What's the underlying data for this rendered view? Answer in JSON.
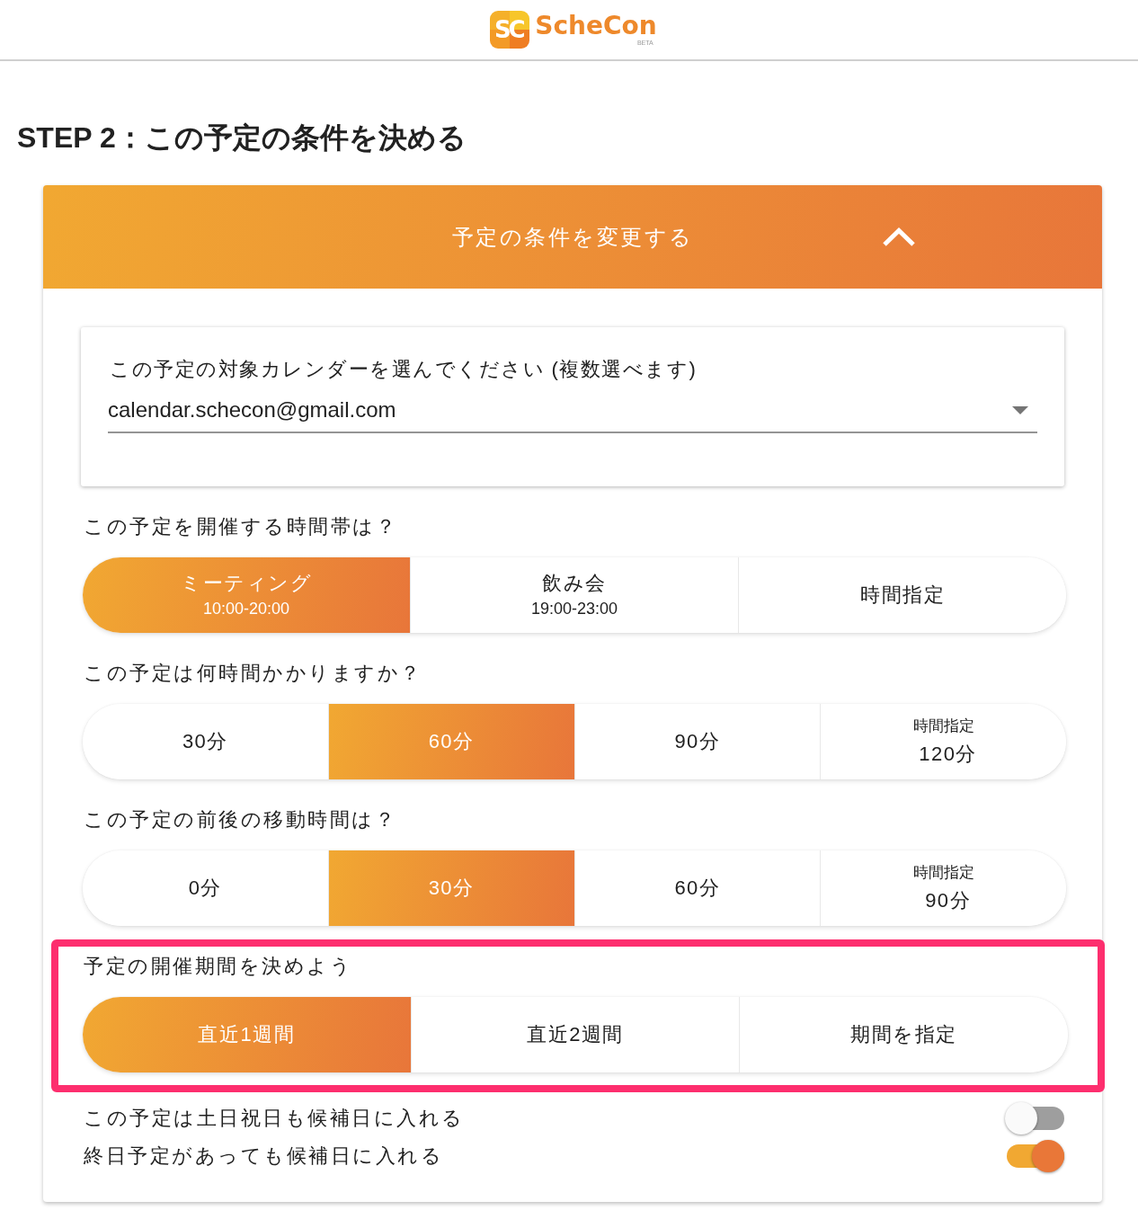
{
  "header": {
    "logo_mark": "SC",
    "logo_text": "ScheCon",
    "logo_badge": "BETA"
  },
  "step_title": "STEP 2：この予定の条件を決める",
  "panel": {
    "title": "予定の条件を変更する",
    "expanded": true
  },
  "calendar_select": {
    "label": "この予定の対象カレンダーを選んでください (複数選べます)",
    "value": "calendar.schecon@gmail.com"
  },
  "groups": [
    {
      "question": "この予定を開催する時間帯は？",
      "highlighted": false,
      "options": [
        {
          "label": "ミーティング",
          "sublabel": "10:00-20:00",
          "selected": true
        },
        {
          "label": "飲み会",
          "sublabel": "19:00-23:00",
          "selected": false
        },
        {
          "label": "時間指定",
          "selected": false
        }
      ]
    },
    {
      "question": "この予定は何時間かかりますか？",
      "highlighted": false,
      "options": [
        {
          "label": "30分",
          "selected": false
        },
        {
          "label": "60分",
          "selected": true
        },
        {
          "label": "90分",
          "selected": false
        },
        {
          "caption": "時間指定",
          "label": "120分",
          "selected": false
        }
      ]
    },
    {
      "question": "この予定の前後の移動時間は？",
      "highlighted": false,
      "options": [
        {
          "label": "0分",
          "selected": false
        },
        {
          "label": "30分",
          "selected": true
        },
        {
          "label": "60分",
          "selected": false
        },
        {
          "caption": "時間指定",
          "label": "90分",
          "selected": false
        }
      ]
    },
    {
      "question": "予定の開催期間を決めよう",
      "highlighted": true,
      "options": [
        {
          "label": "直近1週間",
          "selected": true
        },
        {
          "label": "直近2週間",
          "selected": false
        },
        {
          "label": "期間を指定",
          "selected": false
        }
      ]
    }
  ],
  "toggles": [
    {
      "label": "この予定は土日祝日も候補日に入れる",
      "on": false
    },
    {
      "label": "終日予定があっても候補日に入れる",
      "on": true
    }
  ]
}
